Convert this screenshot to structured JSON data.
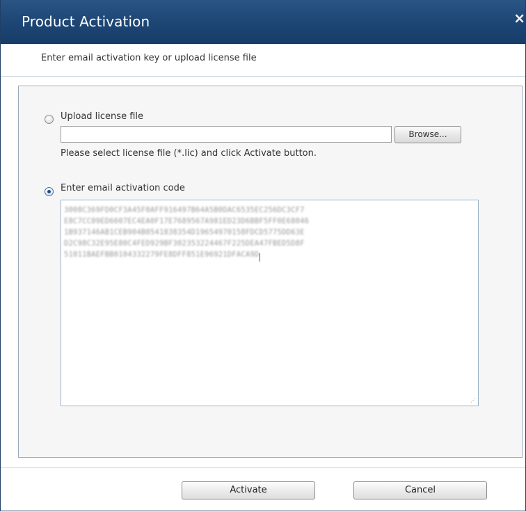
{
  "window": {
    "title": "Product Activation",
    "close_glyph": "×"
  },
  "header": {
    "instruction": "Enter email activation key or upload license file"
  },
  "upload_option": {
    "label": "Upload license file",
    "selected": false,
    "file_value": "",
    "browse_label": "Browse...",
    "hint": "Please select license file (*.lic) and click Activate button."
  },
  "email_option": {
    "label": "Enter email activation code",
    "selected": true,
    "code_lines": [
      "3008C369FD0CF3A45F0AFF916497B64A5B0DAC6535EC256DC3CF7",
      "E8C7CC09ED6607EC4EA0F17E7689567A981ED23D6BBF5FF0E68046",
      "1B937146AB1CEB904B0541838354D19654970158FDCD5775DD63E",
      "D2C98C32E95E80C4FED929BF302353224467F225DEA47FBED5D8F",
      "51011BAEFBB0104332279FE8DFF851E96921DFACA9D"
    ]
  },
  "buttons": {
    "activate": "Activate",
    "cancel": "Cancel"
  },
  "colors": {
    "titlebar": "#1f4877",
    "panel_bg": "#f6f6f6",
    "radio_selected_dot": "#1b4b86"
  },
  "icons": {
    "close": "close-icon",
    "radio": "radio-button-icon",
    "resize": "resize-grip-icon"
  }
}
